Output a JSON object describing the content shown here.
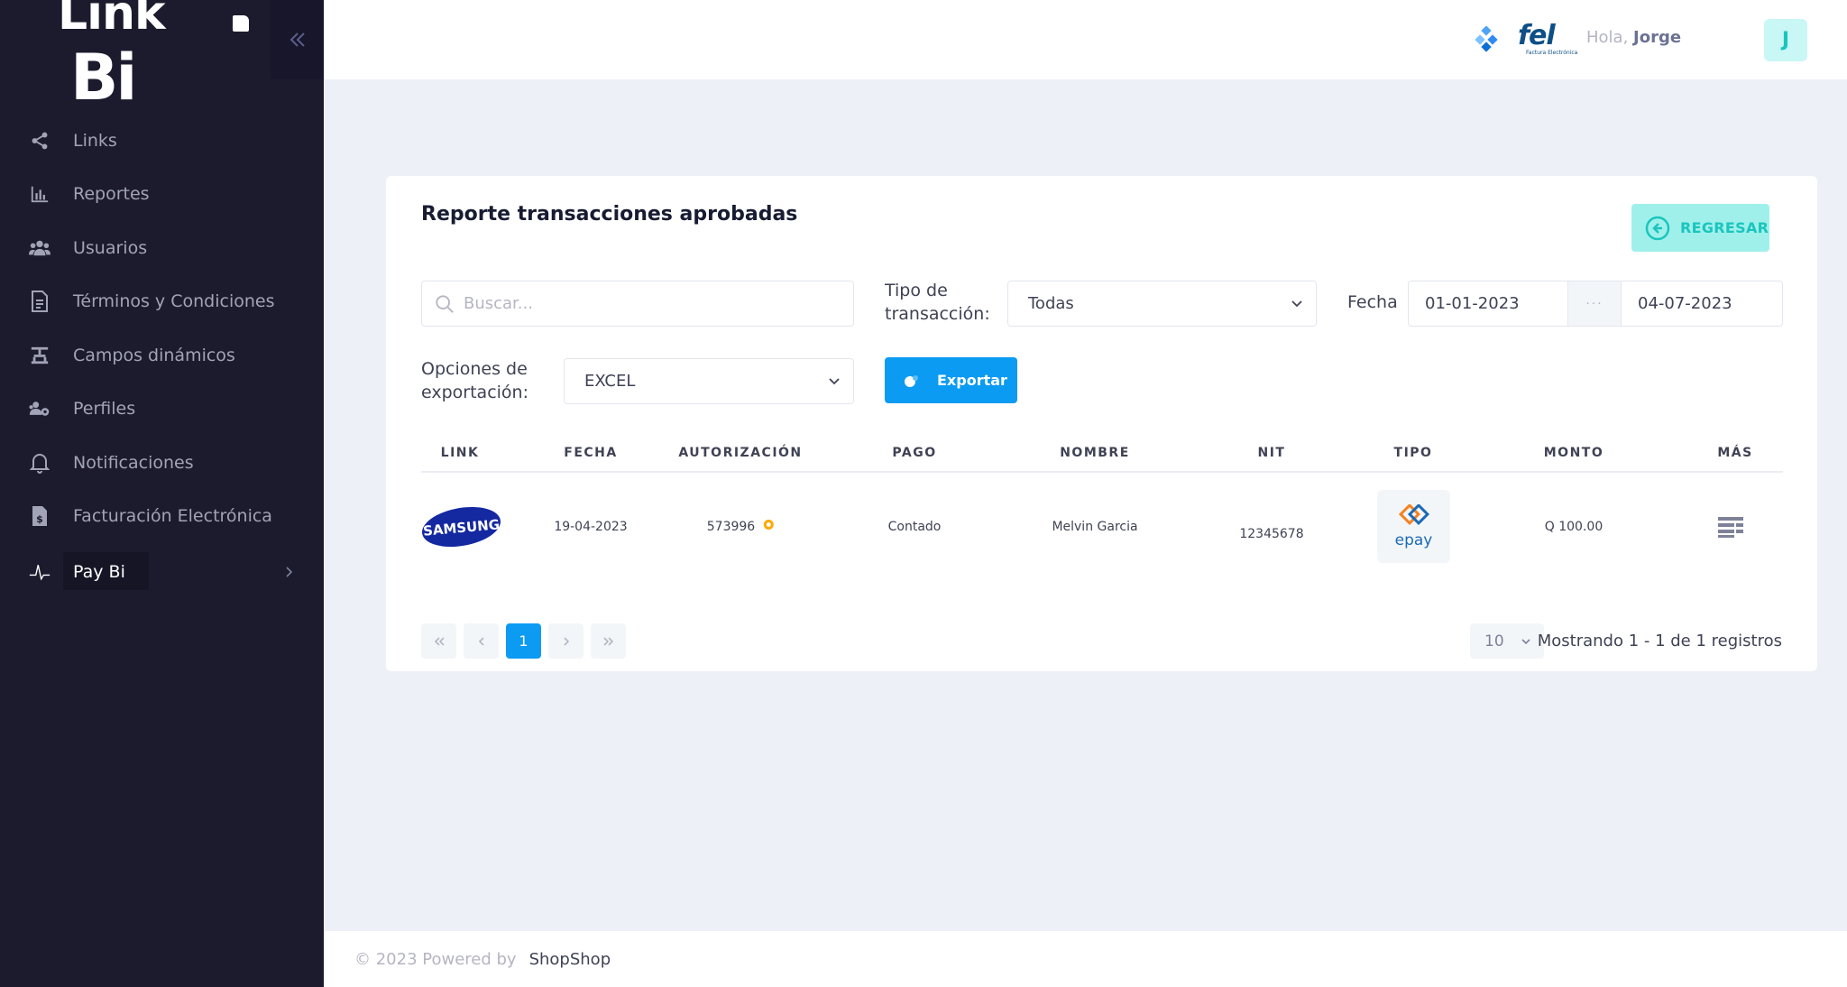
{
  "sidebar": {
    "logo": "Link Bi",
    "items": [
      {
        "label": "Links",
        "icon": "share-icon"
      },
      {
        "label": "Reportes",
        "icon": "bar-chart-icon"
      },
      {
        "label": "Usuarios",
        "icon": "users-icon"
      },
      {
        "label": "Términos y Condiciones",
        "icon": "document-icon"
      },
      {
        "label": "Campos dinámicos",
        "icon": "fields-icon"
      },
      {
        "label": "Perfiles",
        "icon": "profiles-icon"
      },
      {
        "label": "Notificaciones",
        "icon": "bell-icon"
      },
      {
        "label": "Facturación Electrónica",
        "icon": "invoice-icon"
      },
      {
        "label": "Pay Bi",
        "icon": "pay-bi-icon",
        "active": true
      }
    ]
  },
  "header": {
    "fel_logo": "fel",
    "fel_subtitle": "Factura Electrónica",
    "greeting": "Hola,",
    "user_name": "Jorge",
    "avatar_initial": "J"
  },
  "card": {
    "title": "Reporte transacciones aprobadas",
    "back_button": "REGRESAR",
    "search_placeholder": "Buscar...",
    "tipo_label_1": "Tipo de",
    "tipo_label_2": "transacción:",
    "tipo_value": "Todas",
    "fecha_label": "Fecha",
    "date_from": "01-01-2023",
    "date_sep": "···",
    "date_to": "04-07-2023",
    "export_label_1": "Opciones de",
    "export_label_2": "exportación:",
    "export_value": "EXCEL",
    "export_button": "Exportar"
  },
  "table": {
    "columns": [
      "LINK",
      "FECHA",
      "AUTORIZACIÓN",
      "PAGO",
      "NOMBRE",
      "NIT",
      "TIPO",
      "MONTO",
      "MÁS"
    ],
    "rows": [
      {
        "link_logo": "SAMSUNG",
        "fecha": "19-04-2023",
        "autorizacion": "573996",
        "pago": "Contado",
        "nombre": "Melvin Garcia",
        "nit": "12345678",
        "tipo_logo": "epay",
        "monto": "Q 100.00"
      }
    ]
  },
  "pagination": {
    "current_page": "1",
    "page_size": "10",
    "summary": "Mostrando 1 - 1 de 1 registros"
  },
  "footer": {
    "copyright": "© 2023 Powered by",
    "brand": "ShopShop"
  },
  "colors": {
    "sidebar_bg": "#1c1b2e",
    "primary": "#0b9bf2",
    "teal": "#1bc5bd",
    "teal_light": "#9ff0eb",
    "page_bg": "#eef0f8"
  }
}
